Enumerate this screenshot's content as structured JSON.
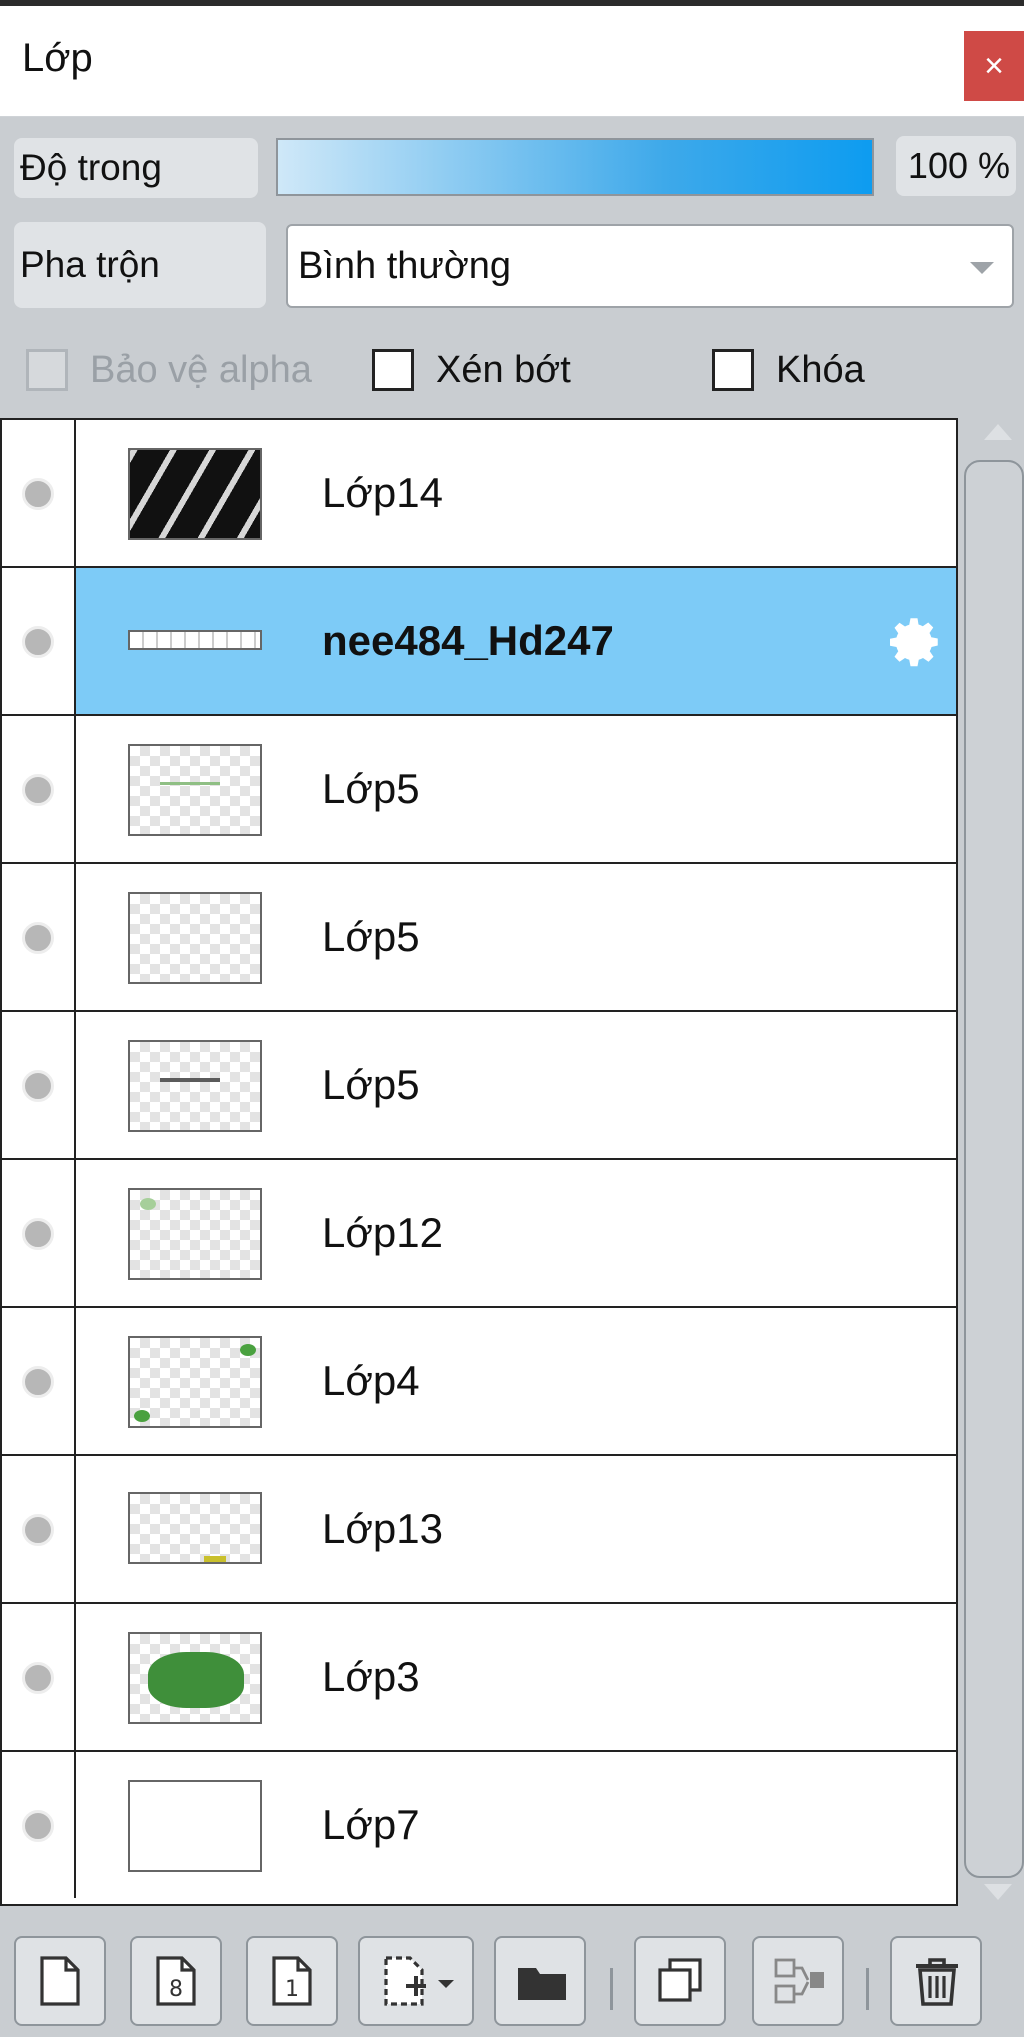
{
  "panel": {
    "title": "Lớp",
    "close_label": "×"
  },
  "opacity": {
    "label": "Độ trong",
    "value": "100 %"
  },
  "blend": {
    "label": "Pha trộn",
    "value": "Bình thường"
  },
  "options": {
    "protect_alpha": "Bảo vệ alpha",
    "clip": "Xén bớt",
    "lock": "Khóa"
  },
  "layers": [
    {
      "name": "Lớp14"
    },
    {
      "name": "nee484_Hd247",
      "selected": true
    },
    {
      "name": "Lớp5"
    },
    {
      "name": "Lớp5"
    },
    {
      "name": "Lớp5"
    },
    {
      "name": "Lớp12"
    },
    {
      "name": "Lớp4"
    },
    {
      "name": "Lớp13"
    },
    {
      "name": "Lớp3"
    },
    {
      "name": "Lớp7"
    }
  ],
  "toolbar": {
    "new_layer_icon": "new-page-icon",
    "layer_8_badge": "8",
    "layer_1_badge": "1",
    "add_icon": "add-layer-icon",
    "folder_icon": "folder-icon",
    "duplicate_icon": "duplicate-icon",
    "merge_icon": "merge-icon",
    "delete_icon": "trash-icon"
  },
  "colors": {
    "selected_row": "#7dcbf7",
    "close": "#cf4a46",
    "panel_bg": "#c9cdd1"
  }
}
